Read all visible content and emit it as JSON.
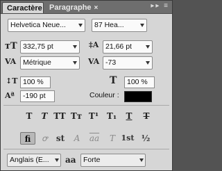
{
  "tabs": [
    {
      "label": "Caractère",
      "active": true
    },
    {
      "label": "Paragraphe",
      "active": false
    }
  ],
  "tab_close_glyph": "×",
  "panel_menu_glyphs": "▸▸ ≡",
  "font": {
    "family": "Helvetica Neue...",
    "style": "87 Hea..."
  },
  "size": {
    "value": "332,75 pt"
  },
  "leading": {
    "value": "21,66 pt"
  },
  "kerning": {
    "value": "Métrique"
  },
  "tracking": {
    "value": "-73"
  },
  "vertical_scale": {
    "value": "100 %"
  },
  "horizontal_scale": {
    "value": "100 %"
  },
  "baseline_shift": {
    "value": "-190 pt"
  },
  "color": {
    "label": "Couleur :",
    "value": "#000000"
  },
  "style_buttons": [
    {
      "name": "faux-bold",
      "glyph": "T"
    },
    {
      "name": "faux-italic",
      "glyph": "T"
    },
    {
      "name": "all-caps",
      "glyph": "TT"
    },
    {
      "name": "small-caps",
      "glyph": "Tт"
    },
    {
      "name": "superscript",
      "glyph": "T¹"
    },
    {
      "name": "subscript",
      "glyph": "T₁"
    },
    {
      "name": "underline",
      "glyph": "T"
    },
    {
      "name": "strikethrough",
      "glyph": "T"
    }
  ],
  "opentype_buttons": [
    {
      "name": "ligatures",
      "glyph": "fi"
    },
    {
      "name": "discretionary-ligatures",
      "glyph": "ꝍ"
    },
    {
      "name": "contextual-alternates",
      "glyph": "st"
    },
    {
      "name": "swash",
      "glyph": "A"
    },
    {
      "name": "stylistic-alternates",
      "glyph": "aa"
    },
    {
      "name": "titling-alternates",
      "glyph": "T"
    },
    {
      "name": "ordinals",
      "glyph": "1st"
    },
    {
      "name": "fractions",
      "glyph": "½"
    }
  ],
  "language": {
    "value": "Anglais (E..."
  },
  "antialias": {
    "icon": "aa",
    "value": "Forte"
  }
}
